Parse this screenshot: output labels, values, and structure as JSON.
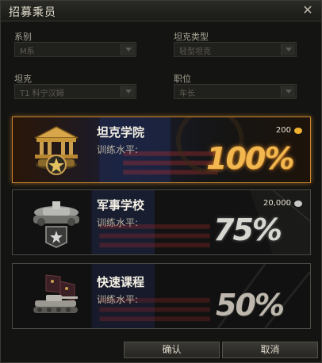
{
  "window": {
    "title": "招募乘员"
  },
  "filters": {
    "nation_label": "系别",
    "nation_value": "M系",
    "tank_type_label": "坦克类型",
    "tank_type_value": "轻型坦克",
    "tank_label": "坦克",
    "tank_value": "T1 科宁汉姆",
    "role_label": "职位",
    "role_value": "车长"
  },
  "options": [
    {
      "name": "坦克学院",
      "training_label": "训练水平:",
      "cost": "200",
      "currency": "gold",
      "percent": "100%",
      "selected": true
    },
    {
      "name": "军事学校",
      "training_label": "训练水平:",
      "cost": "20,000",
      "currency": "credits",
      "percent": "75%",
      "selected": false
    },
    {
      "name": "快速课程",
      "training_label": "训练水平:",
      "cost": "",
      "currency": "none",
      "percent": "50%",
      "selected": false
    }
  ],
  "buttons": {
    "confirm": "确认",
    "cancel": "取消"
  },
  "colors": {
    "selected_border": "#c9862f",
    "gold": "#f0b030",
    "silver": "#c8c8c8"
  }
}
